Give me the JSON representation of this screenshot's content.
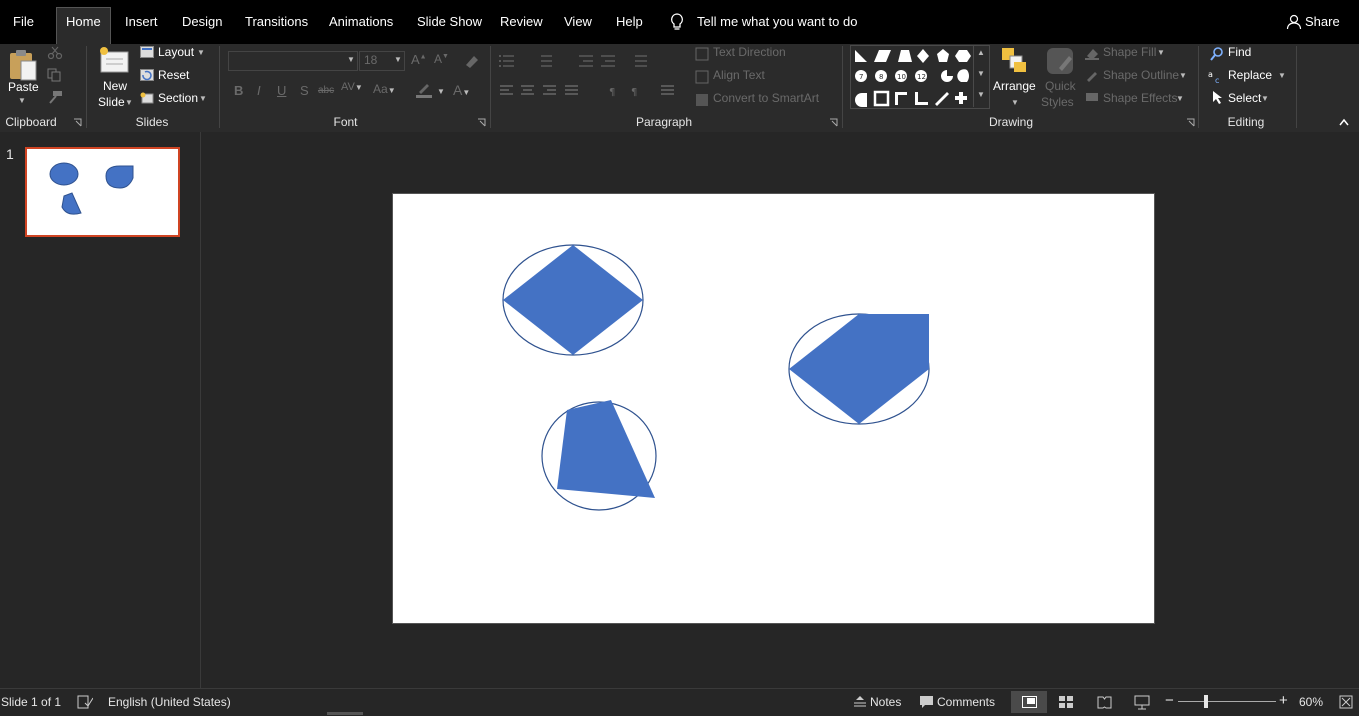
{
  "menu": {
    "file": "File",
    "home": "Home",
    "insert": "Insert",
    "design": "Design",
    "transitions": "Transitions",
    "animations": "Animations",
    "slideshow": "Slide Show",
    "review": "Review",
    "view": "View",
    "help": "Help",
    "tell_me": "Tell me what you want to do",
    "share": "Share"
  },
  "clipboard": {
    "paste": "Paste",
    "label": "Clipboard"
  },
  "slides": {
    "new_slide_line1": "New",
    "new_slide_line2": "Slide",
    "layout": "Layout",
    "reset": "Reset",
    "section": "Section",
    "label": "Slides"
  },
  "font": {
    "size": "18",
    "label": "Font"
  },
  "paragraph": {
    "text_direction": "Text Direction",
    "align_text": "Align Text",
    "smartart": "Convert to SmartArt",
    "label": "Paragraph"
  },
  "drawing": {
    "arrange": "Arrange",
    "quick_line1": "Quick",
    "quick_line2": "Styles",
    "shape_fill": "Shape Fill",
    "shape_outline": "Shape Outline",
    "shape_effects": "Shape Effects",
    "label": "Drawing"
  },
  "editing": {
    "find": "Find",
    "replace": "Replace",
    "select": "Select",
    "label": "Editing"
  },
  "thumbs": {
    "slide_number": "1"
  },
  "status": {
    "slide_of": "Slide 1 of 1",
    "language": "English (United States)",
    "notes": "Notes",
    "comments": "Comments",
    "zoom": "60%"
  },
  "colors": {
    "shape_fill": "#4472c4",
    "shape_outline": "#2f528f",
    "selection": "#d04423"
  }
}
